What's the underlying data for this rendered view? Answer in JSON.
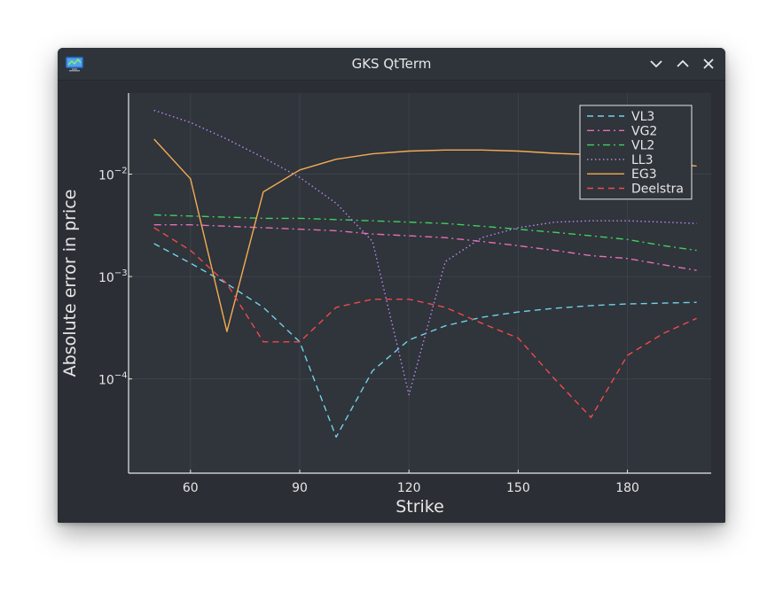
{
  "window": {
    "title": "GKS QtTerm",
    "icon": "gks-monitor-icon",
    "controls": [
      "minimize-icon",
      "maximize-icon",
      "close-icon"
    ]
  },
  "colors": {
    "background": "#2b2f35",
    "plot_bg": "#30343b",
    "grid": "#3d4249",
    "axis": "#e6e6e6",
    "text": "#e6e6e6"
  },
  "chart_data": {
    "type": "line",
    "xlabel": "Strike",
    "ylabel": "Absolute error in price",
    "xscale": "linear",
    "yscale": "log",
    "xlim": [
      43,
      203
    ],
    "ylim": [
      1.2e-05,
      0.062
    ],
    "xticks": [
      60,
      90,
      120,
      150,
      180
    ],
    "xtick_labels": [
      "60",
      "90",
      "120",
      "150",
      "180"
    ],
    "yticks": [
      0.0001,
      0.001,
      0.01
    ],
    "ytick_labels": [
      {
        "base": "10",
        "exp": "−4"
      },
      {
        "base": "10",
        "exp": "−3"
      },
      {
        "base": "10",
        "exp": "−2"
      }
    ],
    "grid": true,
    "legend_position": "top-right",
    "x": [
      50,
      60,
      70,
      80,
      90,
      100,
      110,
      120,
      130,
      140,
      150,
      160,
      170,
      180,
      190,
      199
    ],
    "series": [
      {
        "name": "VL3",
        "color": "#6fd3e8",
        "style": "dashed",
        "values": [
          0.0021,
          0.00135,
          0.00085,
          0.0005,
          0.00023,
          2.7e-05,
          0.00012,
          0.00024,
          0.00033,
          0.0004,
          0.00045,
          0.00049,
          0.00052,
          0.00054,
          0.00055,
          0.00056
        ]
      },
      {
        "name": "VG2",
        "color": "#e46fb2",
        "style": "dashdot",
        "values": [
          0.0032,
          0.0032,
          0.0031,
          0.003,
          0.0029,
          0.0028,
          0.0026,
          0.0025,
          0.0024,
          0.0022,
          0.002,
          0.0018,
          0.0016,
          0.0015,
          0.0013,
          0.00115
        ]
      },
      {
        "name": "VL2",
        "color": "#3fcf5e",
        "style": "dashdot",
        "values": [
          0.004,
          0.0039,
          0.0038,
          0.0037,
          0.0037,
          0.0036,
          0.0035,
          0.0034,
          0.0033,
          0.0031,
          0.0029,
          0.0027,
          0.0025,
          0.0023,
          0.002,
          0.0018
        ]
      },
      {
        "name": "LL3",
        "color": "#b78cf0",
        "style": "dotted",
        "values": [
          0.042,
          0.032,
          0.022,
          0.0145,
          0.0093,
          0.0052,
          0.0022,
          7e-05,
          0.0014,
          0.0024,
          0.003,
          0.0034,
          0.0035,
          0.0035,
          0.0034,
          0.0033
        ]
      },
      {
        "name": "EG3",
        "color": "#f2ad52",
        "style": "solid",
        "values": [
          0.022,
          0.009,
          0.00029,
          0.0067,
          0.011,
          0.014,
          0.0158,
          0.0168,
          0.0172,
          0.0172,
          0.0168,
          0.016,
          0.0155,
          0.014,
          0.013,
          0.012
        ]
      },
      {
        "name": "Deelstra",
        "color": "#ef4a4a",
        "style": "dashed",
        "values": [
          0.003,
          0.0018,
          0.00085,
          0.00023,
          0.00023,
          0.0005,
          0.0006,
          0.0006,
          0.0005,
          0.00035,
          0.00025,
          0.0001,
          4.2e-05,
          0.00017,
          0.00028,
          0.00039
        ]
      }
    ]
  }
}
